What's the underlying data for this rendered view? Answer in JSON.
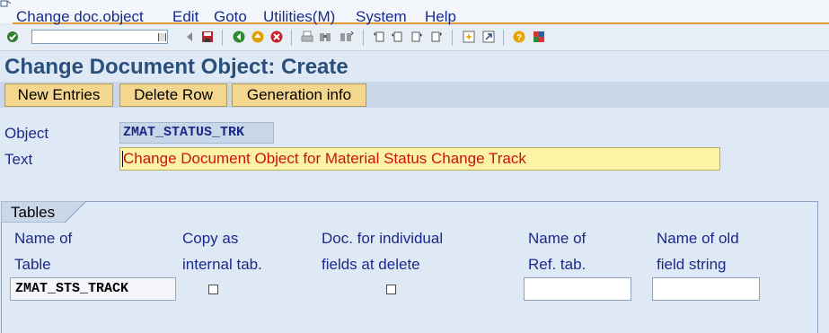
{
  "menu": {
    "items": [
      "Change doc.object",
      "Edit",
      "Goto",
      "Utilities(M)",
      "System",
      "Help"
    ]
  },
  "toolbar": {
    "command_field_value": "",
    "icons": [
      "enter-icon",
      "save-icon",
      "back-icon",
      "exit-icon",
      "cancel-icon",
      "print-icon",
      "find-icon",
      "find-next-icon",
      "first-page-icon",
      "previous-page-icon",
      "next-page-icon",
      "last-page-icon",
      "create-session-icon",
      "shortcut-icon",
      "help-icon",
      "customize-layout-icon"
    ]
  },
  "page": {
    "title": "Change Document Object: Create"
  },
  "app_toolbar": {
    "new_entries": "New Entries",
    "delete_row": "Delete Row",
    "generation_info": "Generation info"
  },
  "fields": {
    "object_label": "Object",
    "object_value": "ZMAT_STATUS_TRK",
    "text_label": "Text",
    "text_value": "Change Document Object for Material Status Change Track"
  },
  "tables": {
    "group_title": "Tables",
    "columns": [
      {
        "line1": "Name of",
        "line2": "Table"
      },
      {
        "line1": "Copy as",
        "line2": "internal tab."
      },
      {
        "line1": "Doc. for individual",
        "line2": "fields at delete"
      },
      {
        "line1": "Name of",
        "line2": "Ref. tab."
      },
      {
        "line1": "Name of old",
        "line2": "field string"
      }
    ],
    "rows": [
      {
        "table_name": "ZMAT_STS_TRACK",
        "copy_internal": false,
        "doc_individual": false,
        "ref_tab": "",
        "old_field_string": ""
      }
    ]
  },
  "colors": {
    "title": "#2a4f7b",
    "label": "#1b2a8a",
    "button_bg": "#f3d78f",
    "text_value": "#cc1111",
    "accent_line": "#e39a3c"
  }
}
